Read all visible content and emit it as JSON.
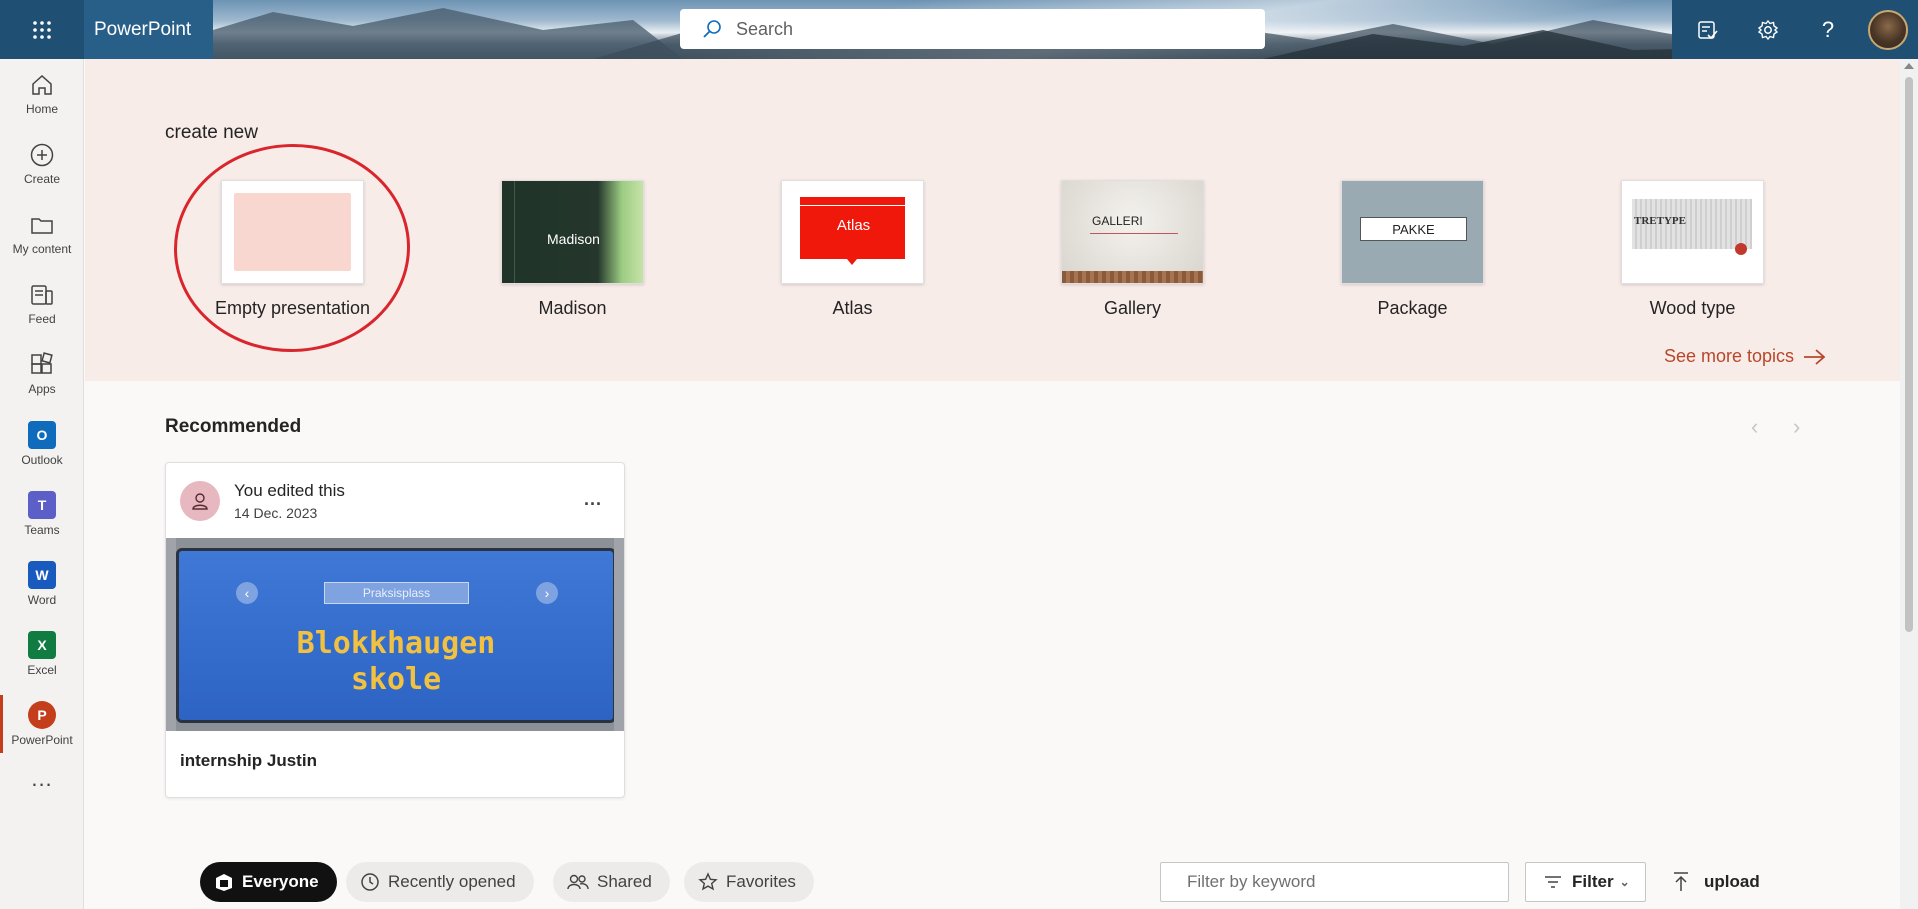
{
  "topbar": {
    "app_name": "PowerPoint",
    "search_placeholder": "Search",
    "icons": [
      "waffle-icon",
      "search-icon",
      "whats-new-icon",
      "settings-icon",
      "help-icon",
      "avatar"
    ]
  },
  "rail": {
    "items": [
      {
        "label": "Home",
        "icon": "home-icon"
      },
      {
        "label": "Create",
        "icon": "plus-circle-icon"
      },
      {
        "label": "My content",
        "icon": "folder-icon"
      },
      {
        "label": "Feed",
        "icon": "feed-icon"
      },
      {
        "label": "Apps",
        "icon": "apps-icon"
      },
      {
        "label": "Outlook",
        "icon": "outlook-icon",
        "letter": "O",
        "color": "#0f6cbd"
      },
      {
        "label": "Teams",
        "icon": "teams-icon",
        "letter": "T",
        "color": "#5b5fc7"
      },
      {
        "label": "Word",
        "icon": "word-icon",
        "letter": "W",
        "color": "#185abd"
      },
      {
        "label": "Excel",
        "icon": "excel-icon",
        "letter": "X",
        "color": "#107c41"
      },
      {
        "label": "PowerPoint",
        "icon": "powerpoint-icon",
        "letter": "P",
        "color": "#c43e1c"
      }
    ],
    "more": "..."
  },
  "create_new": {
    "title": "create new",
    "templates": [
      {
        "name": "Empty presentation"
      },
      {
        "name": "Madison",
        "thumb_text": "Madison"
      },
      {
        "name": "Atlas",
        "thumb_text": "Atlas"
      },
      {
        "name": "Gallery",
        "thumb_text": "GALLERI"
      },
      {
        "name": "Package",
        "thumb_text": "PAKKE"
      },
      {
        "name": "Wood type",
        "thumb_text": "TRETYPE"
      }
    ],
    "see_more": "See more topics"
  },
  "recommended": {
    "title": "Recommended",
    "card": {
      "activity": "You edited this",
      "date": "14 Dec. 2023",
      "more": "...",
      "preview_banner": "Praksisplass",
      "preview_title_1": "Blokkhaugen",
      "preview_title_2": "skole",
      "filename": "internship Justin"
    }
  },
  "filters": {
    "pills": [
      "Everyone",
      "Recently opened",
      "Shared",
      "Favorites"
    ],
    "keyword_placeholder": "Filter by keyword",
    "filter_label": "Filter",
    "upload_label": "upload"
  },
  "colors": {
    "accent": "#c43e1c",
    "create_band": "#f8ece9",
    "highlight_circle": "#d9262c"
  }
}
